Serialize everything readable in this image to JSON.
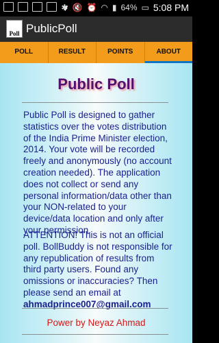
{
  "status_bar": {
    "time": "5:08 PM",
    "battery": "64%"
  },
  "app": {
    "icon_label": "Poll",
    "title": "PublicPoll"
  },
  "tabs": [
    {
      "label": "POLL"
    },
    {
      "label": "RESULT"
    },
    {
      "label": "POINTS"
    },
    {
      "label": "ABOUT"
    }
  ],
  "about": {
    "heading": "Public Poll",
    "paragraph1": "Public Poll is designed to gather statistics over the votes distribution of the India Prime Minister election, 2014. Your vote will be recorded freely and anonymously (no account creation needed). The application does not collect or send any personal information/data other than your NON-related to your device/data location and only after your permission.",
    "paragraph2": "ATTENTION! This is not an official poll. BollBuddy is not responsible for any republication of results from third party users. Found any omissions or inaccuracies? Then please send an email at",
    "email": "ahmadprince007@gmail.com",
    "footer": "Power by Neyaz Ahmad"
  },
  "colors": {
    "tab_bar": "#f39b1a",
    "tab_indicator": "#0f74c4",
    "body_text": "#191f8f",
    "heading": "#52116d",
    "footer": "#d91616"
  }
}
